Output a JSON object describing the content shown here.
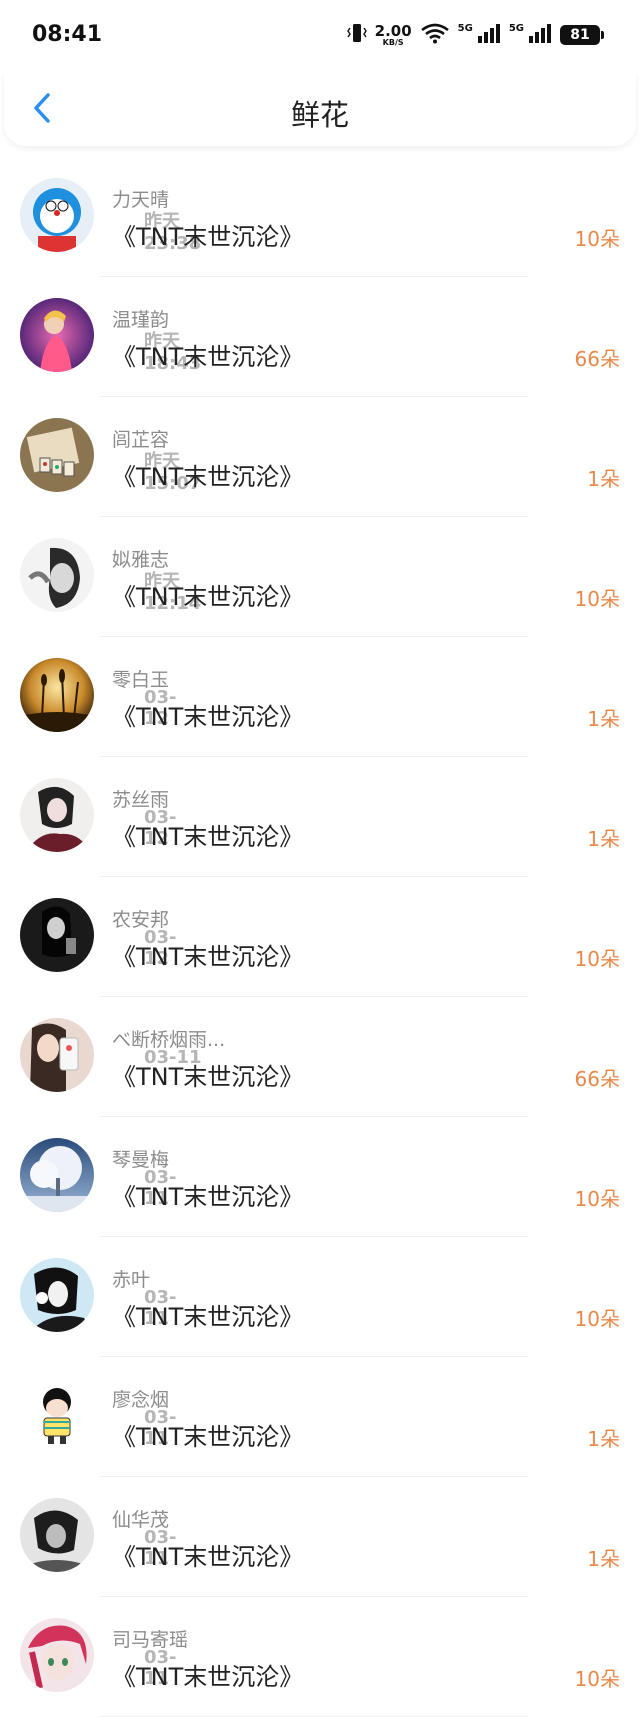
{
  "status_bar": {
    "time": "08:41",
    "speed_value": "2.00",
    "speed_unit": "KB/S",
    "network_1": "5G",
    "network_2": "5G",
    "battery": "81"
  },
  "header": {
    "title": "鲜花",
    "back_icon": "chevron-left-icon",
    "accent_color": "#2b8df0"
  },
  "gifts": [
    {
      "name": "力天晴",
      "time": "昨天 23:38",
      "book": "《TNT末世沉沦》",
      "count": "10朵",
      "avatar_icon": "doraemon-avatar"
    },
    {
      "name": "温瑾韵",
      "time": "昨天 18:43",
      "book": "《TNT末世沉沦》",
      "count": "66朵",
      "avatar_icon": "singer-avatar"
    },
    {
      "name": "闾芷容",
      "time": "昨天 15:07",
      "book": "《TNT末世沉沦》",
      "count": "1朵",
      "avatar_icon": "mahjong-avatar"
    },
    {
      "name": "姒雅志",
      "time": "昨天 12:14",
      "book": "《TNT末世沉沦》",
      "count": "10朵",
      "avatar_icon": "bw-portrait-avatar"
    },
    {
      "name": "零白玉",
      "time": "03-12",
      "book": "《TNT末世沉沦》",
      "count": "1朵",
      "avatar_icon": "sunset-reeds-avatar"
    },
    {
      "name": "苏丝雨",
      "time": "03-12",
      "book": "《TNT末世沉沦》",
      "count": "1朵",
      "avatar_icon": "anime-girl-avatar"
    },
    {
      "name": "农安邦",
      "time": "03-12",
      "book": "《TNT末世沉沦》",
      "count": "10朵",
      "avatar_icon": "dark-girl-avatar"
    },
    {
      "name": "べ断桥烟雨...",
      "time": "03-11",
      "book": "《TNT末世沉沦》",
      "count": "66朵",
      "avatar_icon": "selfie-girl-avatar"
    },
    {
      "name": "琴曼梅",
      "time": "03-11",
      "book": "《TNT末世沉沦》",
      "count": "10朵",
      "avatar_icon": "snow-tree-avatar"
    },
    {
      "name": "赤叶",
      "time": "03-11",
      "book": "《TNT末世沉沦》",
      "count": "10朵",
      "avatar_icon": "boy-headphones-avatar"
    },
    {
      "name": "廖念烟",
      "time": "03-11",
      "book": "《TNT末世沉沦》",
      "count": "1朵",
      "avatar_icon": "cartoon-kid-avatar"
    },
    {
      "name": "仙华茂",
      "time": "03-11",
      "book": "《TNT末世沉沦》",
      "count": "1朵",
      "avatar_icon": "moody-face-avatar"
    },
    {
      "name": "司马寄瑶",
      "time": "03-11",
      "book": "《TNT末世沉沦》",
      "count": "10朵",
      "avatar_icon": "red-hair-anime-avatar"
    }
  ],
  "colors": {
    "count": "#e8894a",
    "name": "#8c8c8c",
    "time": "#b5b5b5",
    "book": "#222222"
  }
}
